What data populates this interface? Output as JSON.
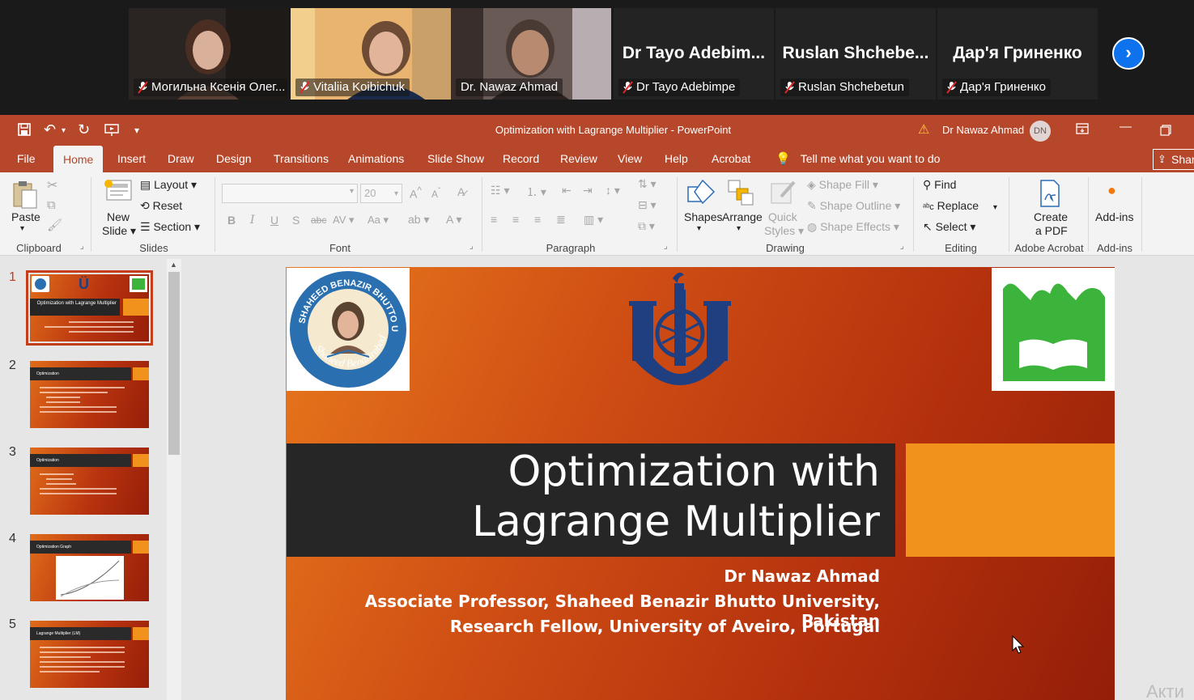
{
  "meeting": {
    "participants": [
      {
        "name": "Могильна Ксенія Олег...",
        "muted": true,
        "video": true
      },
      {
        "name": "Vitaliia Koibichuk",
        "muted": true,
        "video": true
      },
      {
        "name": "Dr. Nawaz Ahmad",
        "muted": false,
        "video": true,
        "active_speaker": true
      },
      {
        "name": "Dr Tayo Adebimpe",
        "display": "Dr Tayo  Adebim...",
        "muted": true,
        "video": false
      },
      {
        "name": "Ruslan Shchebetun",
        "display": "Ruslan  Shchebe...",
        "muted": true,
        "video": false
      },
      {
        "name": "Дар'я Гриненко",
        "display": "Дар'я Гриненко",
        "muted": true,
        "video": false
      }
    ],
    "next_label": "›",
    "active_color": "#23d959"
  },
  "window": {
    "title": "Optimization with Lagrange Multiplier  -  PowerPoint",
    "user": "Dr Nawaz Ahmad",
    "user_initials": "DN",
    "accent": "#b7472a"
  },
  "tabs": [
    "File",
    "Home",
    "Insert",
    "Draw",
    "Design",
    "Transitions",
    "Animations",
    "Slide Show",
    "Record",
    "Review",
    "View",
    "Help",
    "Acrobat"
  ],
  "tellme": "Tell me what you want to do",
  "share": "Shar",
  "ribbon": {
    "paste": "Paste",
    "clipboard": "Clipboard",
    "new_slide_1": "New",
    "new_slide_2": "Slide",
    "layout": "Layout",
    "reset": "Reset",
    "section": "Section",
    "slides": "Slides",
    "font_size": "20",
    "font": "Font",
    "paragraph": "Paragraph",
    "shapes": "Shapes",
    "arrange": "Arrange",
    "quick_1": "Quick",
    "quick_2": "Styles",
    "shape_fill": "Shape Fill",
    "shape_outline": "Shape Outline",
    "shape_effects": "Shape Effects",
    "drawing": "Drawing",
    "find": "Find",
    "replace": "Replace",
    "select": "Select",
    "editing": "Editing",
    "create_pdf_1": "Create",
    "create_pdf_2": "a PDF",
    "adobe": "Adobe Acrobat",
    "addins_btn": "Add-ins",
    "addins_group": "Add-ins"
  },
  "thumbnails": [
    {
      "num": "1",
      "title": "Optimization with Lagrange Multiplier"
    },
    {
      "num": "2",
      "title": "Optimization"
    },
    {
      "num": "3",
      "title": "Optimization"
    },
    {
      "num": "4",
      "title": "Optimization Graph"
    },
    {
      "num": "5",
      "title": "Lagrange Multiplier (LM)"
    }
  ],
  "slide": {
    "title_line1": "Optimization with",
    "title_line2": "Lagrange Multiplier",
    "author": "Dr Nawaz Ahmad",
    "affiliation1": "Associate Professor, Shaheed Benazir Bhutto University, Pakistan",
    "affiliation2": "Research Fellow, University of Aveiro, Portugal",
    "logo_left_text": "SHAHEED BENAZIR BHUTTO UNIVERSITY",
    "logo_left_bottom": "Shaheed Benazirabad"
  },
  "watermark": "Акти"
}
